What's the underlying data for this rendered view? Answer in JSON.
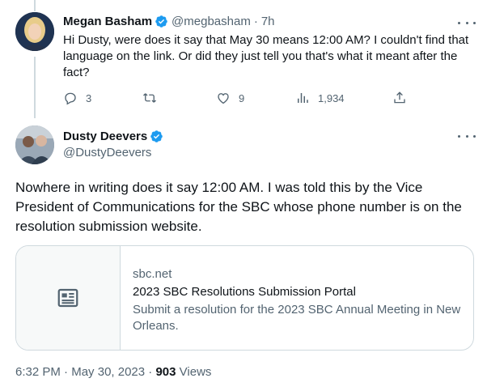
{
  "reply": {
    "name": "Megan Basham",
    "handle": "@megbasham",
    "separator": "·",
    "time": "7h",
    "text": "Hi Dusty, were does it say that May 30 means 12:00 AM? I couldn't find that language on the link. Or did they just tell you that's what it meant after the fact?",
    "actions": {
      "replies": "3",
      "retweets": "",
      "likes": "9",
      "views": "1,934"
    }
  },
  "main": {
    "name": "Dusty Deevers",
    "handle": "@DustyDeevers",
    "text": "Nowhere in writing does it say 12:00 AM. I was told this by the Vice President of Communications for the SBC whose phone number is on the resolution submission website.",
    "card": {
      "domain": "sbc.net",
      "title": "2023 SBC Resolutions Submission Portal",
      "description": "Submit a resolution for the 2023 SBC Annual Meeting in New Orleans."
    },
    "footer": {
      "time": "6:32 PM",
      "separator1": " · ",
      "date": "May 30, 2023",
      "separator2": " · ",
      "views_count": "903",
      "views_label": " Views"
    }
  },
  "colors": {
    "verified": "#1d9bf0",
    "text": "#0f1419",
    "secondary": "#536471",
    "border": "#cfd9de"
  },
  "icons": {
    "reply": "reply-icon",
    "retweet": "retweet-icon",
    "like": "heart-icon",
    "views": "views-icon",
    "share": "share-icon",
    "card": "article-icon",
    "more": "more-icon",
    "verified": "verified-badge-icon"
  }
}
